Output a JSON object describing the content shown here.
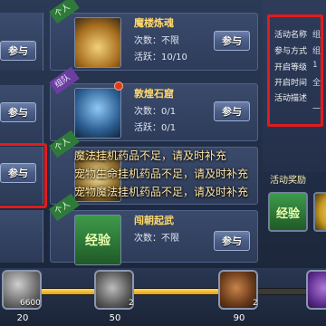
{
  "left_buttons": [
    "参与",
    "参与",
    "参与"
  ],
  "activities": [
    {
      "badge": "个人",
      "title": "魔楼炼魂",
      "stat1": "次数：不限",
      "stat2": "活跃：10/10",
      "button": "参与",
      "thumb_color": "#c58a2a"
    },
    {
      "badge": "组队",
      "title": "敦煌石窟",
      "stat1": "次数：0/1",
      "stat2": "活跃：0/1",
      "button": "参与",
      "thumb_color": "#3a7fb8"
    },
    {
      "badge": "个人",
      "title": "",
      "stat1": "",
      "stat2": "",
      "button": "",
      "thumb_color": "#c6a24a"
    },
    {
      "badge": "个人",
      "title": "闯朝起武",
      "stat1": "次数：不限",
      "stat2": "",
      "button": "参与",
      "thumb_label": "经验",
      "thumb_color": "#2f7d3a"
    }
  ],
  "toasts": [
    "魔法挂机药品不足，请及时补充",
    "宠物生命挂机药品不足，请及时补充",
    "宠物魔法挂机药品不足，请及时补充"
  ],
  "info_panel": {
    "rows": [
      "活动名称",
      "参与方式",
      "开启等级",
      "开启时间",
      "活动描述"
    ],
    "values": [
      "组",
      "组",
      "1",
      "全",
      "一"
    ]
  },
  "rewards": {
    "label": "活动奖励",
    "items": [
      "经验",
      ""
    ]
  },
  "progress": {
    "fraction": 0.72,
    "nodes": [
      {
        "value": "20",
        "count": "6600"
      },
      {
        "value": "50",
        "count": "2"
      },
      {
        "value": "90",
        "count": "2"
      },
      {
        "value": "",
        "count": ""
      }
    ]
  },
  "colors": {
    "highlight": "#e01c1c",
    "title": "#ffd86a",
    "toast": "#ffe7a8",
    "progress": "#e39f18"
  }
}
